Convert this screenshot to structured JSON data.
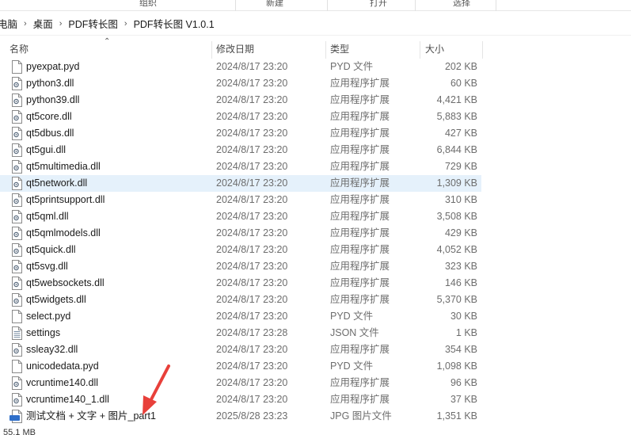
{
  "ribbon": {
    "groups": [
      "组织",
      "新建",
      "打开",
      "选择"
    ]
  },
  "breadcrumb": {
    "items": [
      "电脑",
      "桌面",
      "PDF转长图",
      "PDF转长图 V1.0.1"
    ]
  },
  "columns": {
    "name": "名称",
    "date": "修改日期",
    "type": "类型",
    "size": "大小"
  },
  "files": [
    {
      "name": "pyexpat.pyd",
      "date": "2024/8/17 23:20",
      "type": "PYD 文件",
      "size": "202 KB",
      "icon": "blank-file-icon"
    },
    {
      "name": "python3.dll",
      "date": "2024/8/17 23:20",
      "type": "应用程序扩展",
      "size": "60 KB",
      "icon": "dll-file-icon"
    },
    {
      "name": "python39.dll",
      "date": "2024/8/17 23:20",
      "type": "应用程序扩展",
      "size": "4,421 KB",
      "icon": "dll-file-icon"
    },
    {
      "name": "qt5core.dll",
      "date": "2024/8/17 23:20",
      "type": "应用程序扩展",
      "size": "5,883 KB",
      "icon": "dll-file-icon"
    },
    {
      "name": "qt5dbus.dll",
      "date": "2024/8/17 23:20",
      "type": "应用程序扩展",
      "size": "427 KB",
      "icon": "dll-file-icon"
    },
    {
      "name": "qt5gui.dll",
      "date": "2024/8/17 23:20",
      "type": "应用程序扩展",
      "size": "6,844 KB",
      "icon": "dll-file-icon"
    },
    {
      "name": "qt5multimedia.dll",
      "date": "2024/8/17 23:20",
      "type": "应用程序扩展",
      "size": "729 KB",
      "icon": "dll-file-icon"
    },
    {
      "name": "qt5network.dll",
      "date": "2024/8/17 23:20",
      "type": "应用程序扩展",
      "size": "1,309 KB",
      "icon": "dll-file-icon",
      "highlighted": true
    },
    {
      "name": "qt5printsupport.dll",
      "date": "2024/8/17 23:20",
      "type": "应用程序扩展",
      "size": "310 KB",
      "icon": "dll-file-icon"
    },
    {
      "name": "qt5qml.dll",
      "date": "2024/8/17 23:20",
      "type": "应用程序扩展",
      "size": "3,508 KB",
      "icon": "dll-file-icon"
    },
    {
      "name": "qt5qmlmodels.dll",
      "date": "2024/8/17 23:20",
      "type": "应用程序扩展",
      "size": "429 KB",
      "icon": "dll-file-icon"
    },
    {
      "name": "qt5quick.dll",
      "date": "2024/8/17 23:20",
      "type": "应用程序扩展",
      "size": "4,052 KB",
      "icon": "dll-file-icon"
    },
    {
      "name": "qt5svg.dll",
      "date": "2024/8/17 23:20",
      "type": "应用程序扩展",
      "size": "323 KB",
      "icon": "dll-file-icon"
    },
    {
      "name": "qt5websockets.dll",
      "date": "2024/8/17 23:20",
      "type": "应用程序扩展",
      "size": "146 KB",
      "icon": "dll-file-icon"
    },
    {
      "name": "qt5widgets.dll",
      "date": "2024/8/17 23:20",
      "type": "应用程序扩展",
      "size": "5,370 KB",
      "icon": "dll-file-icon"
    },
    {
      "name": "select.pyd",
      "date": "2024/8/17 23:20",
      "type": "PYD 文件",
      "size": "30 KB",
      "icon": "blank-file-icon"
    },
    {
      "name": "settings",
      "date": "2024/8/17 23:28",
      "type": "JSON 文件",
      "size": "1 KB",
      "icon": "json-file-icon"
    },
    {
      "name": "ssleay32.dll",
      "date": "2024/8/17 23:20",
      "type": "应用程序扩展",
      "size": "354 KB",
      "icon": "dll-file-icon"
    },
    {
      "name": "unicodedata.pyd",
      "date": "2024/8/17 23:20",
      "type": "PYD 文件",
      "size": "1,098 KB",
      "icon": "blank-file-icon"
    },
    {
      "name": "vcruntime140.dll",
      "date": "2024/8/17 23:20",
      "type": "应用程序扩展",
      "size": "96 KB",
      "icon": "dll-file-icon"
    },
    {
      "name": "vcruntime140_1.dll",
      "date": "2024/8/17 23:20",
      "type": "应用程序扩展",
      "size": "37 KB",
      "icon": "dll-file-icon"
    },
    {
      "name": "测试文档 + 文字 + 图片_part1",
      "date": "2025/8/28 23:23",
      "type": "JPG 图片文件",
      "size": "1,351 KB",
      "icon": "jpg-file-icon"
    }
  ],
  "status": {
    "text": "55.1 MB"
  },
  "colors": {
    "highlight": "#e5f1fb",
    "arrow": "#e8403a",
    "jpg_badge": "#2f6fc9"
  }
}
